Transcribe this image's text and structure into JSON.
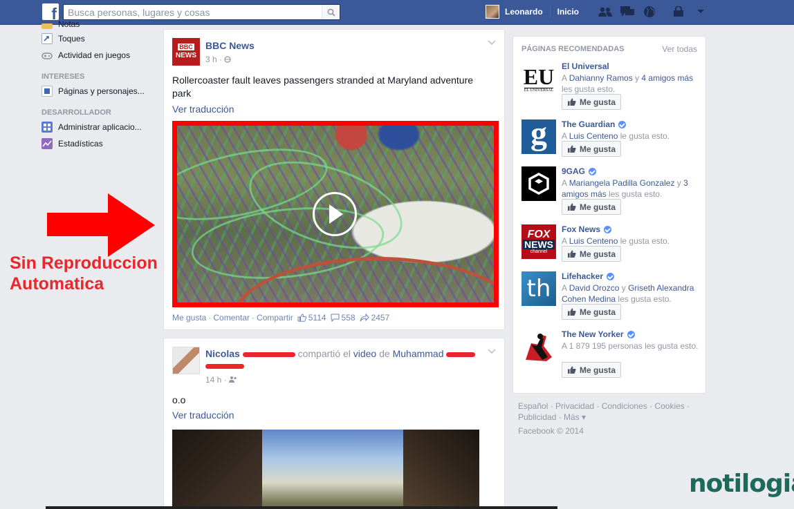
{
  "topbar": {
    "search_placeholder": "Busca personas, lugares y cosas",
    "user_name": "Leonardo",
    "home_label": "Inicio"
  },
  "leftnav": {
    "items_top": [
      {
        "label": "Notas",
        "icon": "notes-icon"
      },
      {
        "label": "Toques",
        "icon": "pokes-icon"
      },
      {
        "label": "Actividad en juegos",
        "icon": "games-icon"
      }
    ],
    "section_interests": "INTERESES",
    "items_interests": [
      {
        "label": "Páginas y personajes...",
        "icon": "pages-icon"
      }
    ],
    "section_developer": "DESARROLLADOR",
    "items_developer": [
      {
        "label": "Administrar aplicacio...",
        "icon": "apps-icon"
      },
      {
        "label": "Estadísticas",
        "icon": "insights-icon"
      }
    ]
  },
  "post1": {
    "author": "BBC News",
    "logo_text_1": "BBC",
    "logo_text_2": "NEWS",
    "time": "3 h ·",
    "text": "Rollercoaster fault leaves passengers stranded at Maryland adventure park",
    "see_translation": "Ver traducción",
    "action_like": "Me gusta",
    "action_comment": "Comentar",
    "action_share": "Compartir",
    "likes": "5114",
    "comments": "558",
    "shares": "2457"
  },
  "post2": {
    "author_first": "Nicolas",
    "shared_text": "compartió el",
    "video_word": "video",
    "of_word": "de",
    "shared_from": "Muhammad",
    "time": "14 h ·",
    "text": "o.o",
    "see_translation": "Ver traducción"
  },
  "annotation": {
    "line1": "Sin Reproduccion",
    "line2": "Automatica",
    "color": "#e8262c"
  },
  "recommended": {
    "title": "PÁGINAS RECOMENDADAS",
    "see_all": "Ver todas",
    "like_label": "Me gusta",
    "pages": [
      {
        "name": "El Universal",
        "verified": false,
        "friends": "Dahianny Ramos",
        "connector": "y",
        "extra": "4 amigos más",
        "suffix": "les gusta esto."
      },
      {
        "name": "The Guardian",
        "verified": true,
        "friends": "Luis Centeno",
        "connector": "",
        "extra": "",
        "suffix": "le gusta esto."
      },
      {
        "name": "9GAG",
        "verified": true,
        "friends": "Mariangela Padilla Gonzalez",
        "connector": "y",
        "extra": "3 amigos más",
        "suffix": "les gusta esto."
      },
      {
        "name": "Fox News",
        "verified": true,
        "friends": "Luis Centeno",
        "connector": "",
        "extra": "",
        "suffix": "le gusta esto."
      },
      {
        "name": "Lifehacker",
        "verified": true,
        "friends": "David Orozco",
        "connector": "y",
        "extra": "Griseth Alexandra Cohen Medina",
        "suffix": "les gusta esto."
      },
      {
        "name": "The New Yorker",
        "verified": true,
        "friends": "",
        "connector": "",
        "extra": "",
        "suffix": "A 1 879 195 personas les gusta esto."
      }
    ],
    "logos": {
      "eu_text": "EU",
      "eu_sub": "EL UNIVERSAL",
      "guardian_text": "g",
      "fox_text_1": "FOX",
      "fox_text_2": "NEWS",
      "fox_text_3": "channel",
      "lh_text": "th"
    }
  },
  "footer": {
    "links_line1": "Español · Privacidad · Condiciones · Cookies ·",
    "links_line2": "Publicidad · Más ▾",
    "copyright": "Facebook © 2014"
  },
  "watermark": "notilogia"
}
